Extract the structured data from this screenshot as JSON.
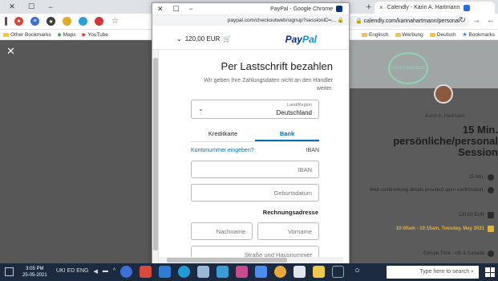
{
  "browser": {
    "tab_title": "Calendly - Karin A. Hartmann",
    "tab_close": "×",
    "new_tab": "+",
    "omnibox_url": "calendly.com/karinahartmann/personal",
    "bookmarks": [
      "Bookmarks",
      "YouTube",
      "Maps",
      "Other Bookmarks",
      "Deutsch",
      "Werbung",
      "Englisch"
    ]
  },
  "popup": {
    "title": "PayPal - Google Chrome",
    "url": "paypal.com/checkoutweb/signup?sessionID=...",
    "logo_left": "Pay",
    "logo_right": "Pal",
    "amount": "120,00 EUR",
    "heading": "Per Lastschrift bezahlen",
    "subtitle": "Wir geben Ihre Zahlungsdaten nicht an den Händler weiter.",
    "country_label": "Land/Region",
    "country_value": "Deutschland",
    "tabs": [
      "Bank",
      "Kreditkarte"
    ],
    "iban_label": "IBAN",
    "iban_link": "Kontonummer eingeben?",
    "iban_placeholder": "IBAN",
    "dob_placeholder": "Geburtsdatum",
    "billing_label": "Rechnungsadresse",
    "firstname_placeholder": "Vorname",
    "lastname_placeholder": "Nachname",
    "street_placeholder": "Straße und Hausnummer"
  },
  "calendly": {
    "logo_text": "Karin Hartmann",
    "host": "Karin A. Hartmann",
    "title": "15 Min. persönliche/personal Session",
    "rows": [
      "15 Min.",
      "Web conferencing details provided upon confirmation.",
      "120,00 EUR",
      "10:00am - 10:15am, Tuesday, May 2021",
      "Europe Time - UK & Canada"
    ]
  },
  "taskbar": {
    "search_placeholder": "Type here to search",
    "time": "3:05 PM",
    "date": "25-05-2021",
    "tray": "UKI ED ENG"
  },
  "colors": {
    "paypal_blue": "#003087",
    "paypal_light": "#009cde",
    "link_blue": "#0070ba",
    "taskbar": "#1c2a40"
  }
}
